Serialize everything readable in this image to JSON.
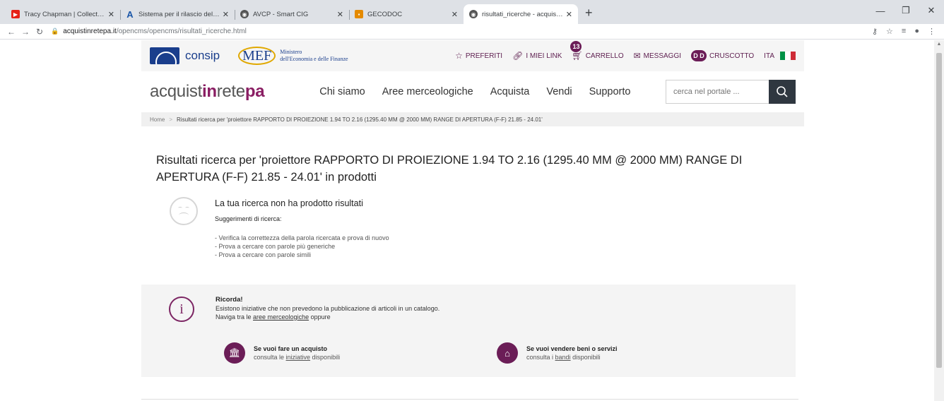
{
  "browser": {
    "tabs": [
      {
        "title": "Tracy Chapman | Collection Full Al",
        "fav_color": "#e62117",
        "fav_glyph": "▶"
      },
      {
        "title": "Sistema per il rilascio del CIG in m",
        "fav_color": "#1a56a8",
        "fav_glyph": "A"
      },
      {
        "title": "AVCP - Smart CIG",
        "fav_color": "#555555",
        "fav_glyph": "◉"
      },
      {
        "title": "GECODOC",
        "fav_color": "#e58a00",
        "fav_glyph": "▪"
      },
      {
        "title": "risultati_ricerche - acquistinretepa",
        "fav_color": "#555555",
        "fav_glyph": "◉"
      }
    ],
    "url_host": "acquistinretepa.it",
    "url_path": "/opencms/opencms/risultati_ricerche.html"
  },
  "topbar": {
    "consip": "consip",
    "mef_logo": "MEF",
    "mef_line1": "Ministero",
    "mef_line2": "dell'Economia e delle Finanze",
    "preferiti": "PREFERITI",
    "imieilink": "I MIEI LINK",
    "cart_count": "13",
    "carrello": "CARRELLO",
    "messaggi": "MESSAGGI",
    "avatar": "D D",
    "cruscotto": "CRUSCOTTO",
    "lang": "ITA"
  },
  "brand": {
    "part1": "acquist",
    "part2": "in",
    "part3": "rete",
    "part4": "pa"
  },
  "nav": [
    "Chi siamo",
    "Aree merceologiche",
    "Acquista",
    "Vendi",
    "Supporto"
  ],
  "search": {
    "placeholder": "cerca nel portale ..."
  },
  "breadcrumb": {
    "home": "Home",
    "current": "Risultati ricerca per 'proiettore RAPPORTO DI PROIEZIONE 1.94 TO 2.16 (1295.40 MM @ 2000 MM) RANGE DI APERTURA (F-F) 21.85 - 24.01'"
  },
  "results": {
    "title": "Risultati ricerca per 'proiettore RAPPORTO DI PROIEZIONE 1.94 TO 2.16 (1295.40 MM @ 2000 MM) RANGE DI APERTURA (F-F) 21.85 - 24.01' in prodotti",
    "no_results": "La tua ricerca non ha prodotto risultati",
    "suggestions_title": "Suggerimenti di ricerca:",
    "suggestions": [
      "- Verifica la correttezza della parola ricercata e prova di nuovo",
      "- Prova a cercare con parole più generiche",
      "- Prova a cercare con parole simili"
    ]
  },
  "remind": {
    "title": "Ricorda!",
    "line1": "Esistono iniziative che non prevedono la pubblicazione di articoli in un catalogo.",
    "line2_pre": "Naviga tra le ",
    "line2_link": "aree merceologiche",
    "line2_post": " oppure",
    "buy_title": "Se vuoi fare un acquisto",
    "buy_pre": "consulta le ",
    "buy_link": "iniziative",
    "buy_post": " disponibili",
    "sell_title": "Se vuoi vendere beni o servizi",
    "sell_pre": "consulta i ",
    "sell_link": "bandi",
    "sell_post": " disponibili"
  },
  "colors": {
    "accent": "#6b1d57",
    "brand_blue": "#1a3e8c"
  }
}
